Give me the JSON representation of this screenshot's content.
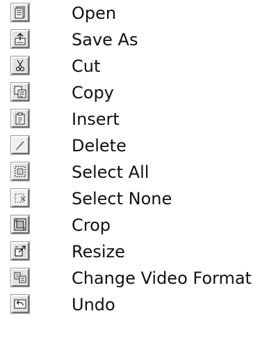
{
  "commands": [
    {
      "label": "Open",
      "icon": "open-icon"
    },
    {
      "label": "Save As",
      "icon": "save-as-icon"
    },
    {
      "label": "Cut",
      "icon": "cut-icon"
    },
    {
      "label": "Copy",
      "icon": "copy-icon"
    },
    {
      "label": "Insert",
      "icon": "insert-icon"
    },
    {
      "label": "Delete",
      "icon": "delete-icon"
    },
    {
      "label": "Select All",
      "icon": "select-all-icon"
    },
    {
      "label": "Select None",
      "icon": "select-none-icon"
    },
    {
      "label": "Crop",
      "icon": "crop-icon"
    },
    {
      "label": "Resize",
      "icon": "resize-icon"
    },
    {
      "label": "Change Video Format",
      "icon": "change-video-format-icon"
    },
    {
      "label": "Undo",
      "icon": "undo-icon"
    }
  ]
}
